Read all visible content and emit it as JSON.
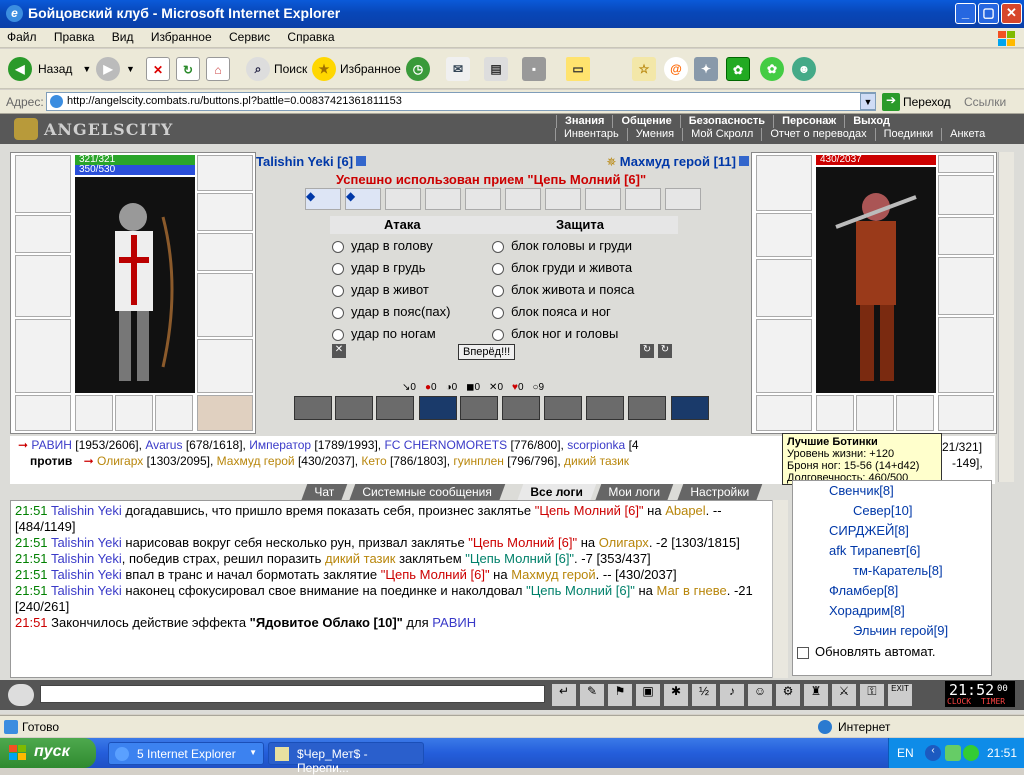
{
  "window": {
    "title": "Бойцовский клуб - Microsoft Internet Explorer"
  },
  "menu": [
    "Файл",
    "Правка",
    "Вид",
    "Избранное",
    "Сервис",
    "Справка"
  ],
  "toolbar": {
    "back": "Назад",
    "search": "Поиск",
    "favorites": "Избранное"
  },
  "address": {
    "label": "Адрес:",
    "url": "http://angelscity.combats.ru/buttons.pl?battle=0.00837421361811153",
    "go": "Переход",
    "links": "Ссылки"
  },
  "game": {
    "logo": "ANGELSCITY",
    "nav_top": [
      "Знания",
      "Общение",
      "Безопасность",
      "Персонаж",
      "Выход"
    ],
    "nav_bottom": [
      "Инвентарь",
      "Умения",
      "Мой Скролл",
      "Отчет о переводах",
      "Поединки",
      "Анкета"
    ],
    "player": {
      "name": "Talishin Yeki [6]",
      "hp": "321/321",
      "mana": "350/530",
      "hp_fill": 1.0,
      "mana_fill": 0.66
    },
    "enemy": {
      "name": "Махмуд герой [11]",
      "hp": "430/2037",
      "hp_fill": 0.21
    },
    "message": "Успешно использован прием \"Цепь Молний [6]\"",
    "attack_title": "Атака",
    "defense_title": "Защита",
    "attacks": [
      "удар в голову",
      "удар в грудь",
      "удар в живот",
      "удар в пояс(пах)",
      "удар по ногам"
    ],
    "blocks": [
      "блок головы и груди",
      "блок груди и живота",
      "блок живота и пояса",
      "блок пояса и ног",
      "блок ног и головы"
    ],
    "go_button": "Вперёд!!!",
    "counters": [
      "0",
      "0",
      "0",
      "0",
      "0",
      "0",
      "9"
    ],
    "team1_prefix": "РАВИН",
    "team1": [
      {
        "name": "РАВИН",
        "hp": "[1953/2606]"
      },
      {
        "name": "Avarus",
        "hp": "[678/1618]"
      },
      {
        "name": "Император",
        "hp": "[1789/1993]"
      },
      {
        "name": "FC CHERNOMORETS",
        "hp": "[776/800]"
      },
      {
        "name": "scorpionka",
        "hp": "[4"
      }
    ],
    "versus": "против",
    "team2": [
      {
        "name": "Олигарх",
        "hp": "[1303/2095]"
      },
      {
        "name": "Махмуд герой",
        "hp": "[430/2037]"
      },
      {
        "name": "Кето",
        "hp": "[786/1803]"
      },
      {
        "name": "гуинплен",
        "hp": "[796/796]"
      },
      {
        "name": "дикий тазик",
        "hp": ""
      }
    ],
    "team_right1": "21/321]",
    "team_right2": "-149],",
    "tooltip": {
      "title": "Лучшие Ботинки",
      "lines": [
        "Уровень жизни: +120",
        "Броня ног: 15-56 (14+d42)",
        "Долговечность: 460/500"
      ]
    }
  },
  "chat": {
    "tabs": [
      "Чат",
      "Системные сообщения",
      "Все логи",
      "Мои логи",
      "Настройки"
    ],
    "lines": [
      {
        "time": "21:51",
        "name": "Talishin Yeki",
        "text": "догадавшись, что пришло время показать себя, произнес заклятье ",
        "spell": "\"Цепь Молний [6]\"",
        "tail": " на ",
        "target": "Abapel",
        "rest": ". -- [484/1149]"
      },
      {
        "time": "21:51",
        "name": "Talishin Yeki",
        "text": "нарисовав вокруг себя несколько рун, призвал заклятье ",
        "spell": "\"Цепь Молний [6]\"",
        "tail": " на ",
        "target": "Олигарх",
        "rest": ". -2 [1303/1815]"
      },
      {
        "time": "21:51",
        "name": "Talishin Yeki",
        "text": ", победив страх, решил поразить ",
        "spell": "дикий тазик",
        "tail": " заклятьем ",
        "target": "\"Цепь Молний [6]\"",
        "rest": ". -7 [353/437]"
      },
      {
        "time": "21:51",
        "name": "Talishin Yeki",
        "text": "впал в транс и начал бормотать заклятие ",
        "spell": "\"Цепь Молний [6]\"",
        "tail": " на ",
        "target": "Махмуд герой",
        "rest": ". -- [430/2037]"
      },
      {
        "time": "21:51",
        "name": "Talishin Yeki",
        "text": "наконец сфокусировал свое внимание на поединке и наколдовал ",
        "spell": "\"Цепь Молний [6]\"",
        "tail": " на ",
        "target": "Маг в гневе",
        "rest": ". -21 [240/261]"
      },
      {
        "time": "21:51",
        "name": "",
        "text": "Закончилось действие эффекта ",
        "spell": "\"Ядовитое Облако [10]\"",
        "tail": " для ",
        "target": "РАВИН",
        "rest": ""
      }
    ]
  },
  "userlist": {
    "users": [
      {
        "name": "Свенчик[8]"
      },
      {
        "name": "Север[10]"
      },
      {
        "name": "СИРДЖЕЙ[8]"
      },
      {
        "name": "afk Тирапевт[6]"
      },
      {
        "name": "тм-Каратель[8]"
      },
      {
        "name": "Фламбер[8]"
      },
      {
        "name": "Хорадрим[8]"
      },
      {
        "name": "Эльчин герой[9]"
      }
    ],
    "auto_refresh": "Обновлять автомат."
  },
  "bottom": {
    "clock": "21:52",
    "clock_sec": "00",
    "clock_label": "CLOCK",
    "timer_label": "TIMER"
  },
  "status": {
    "left": "Готово",
    "zone": "Интернет"
  },
  "taskbar": {
    "start": "пуск",
    "tasks": [
      "5 Internet Explorer",
      "$Чер_Мет$ - Перепи..."
    ],
    "lang": "EN",
    "time": "21:51"
  },
  "colors": {
    "accent_blue": "#0a5ad9",
    "enemy_name": "#b8860b",
    "spell_red": "#cc0000"
  }
}
